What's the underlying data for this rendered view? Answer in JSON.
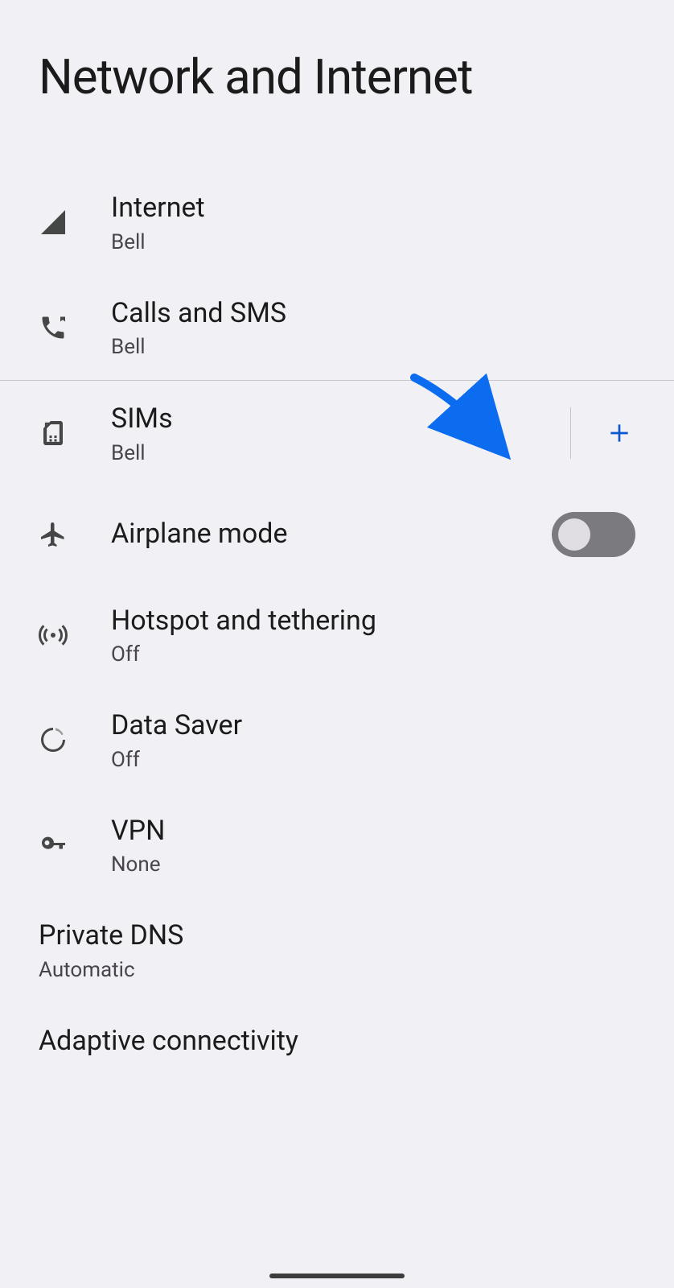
{
  "header": {
    "title": "Network and Internet"
  },
  "items": {
    "internet": {
      "title": "Internet",
      "sub": "Bell"
    },
    "calls_sms": {
      "title": "Calls and SMS",
      "sub": "Bell"
    },
    "sims": {
      "title": "SIMs",
      "sub": "Bell"
    },
    "airplane": {
      "title": "Airplane mode",
      "state": "off"
    },
    "hotspot": {
      "title": "Hotspot and tethering",
      "sub": "Off"
    },
    "data_saver": {
      "title": "Data Saver",
      "sub": "Off"
    },
    "vpn": {
      "title": "VPN",
      "sub": "None"
    },
    "private_dns": {
      "title": "Private DNS",
      "sub": "Automatic"
    },
    "adaptive": {
      "title": "Adaptive connectivity"
    }
  },
  "annotation": {
    "type": "arrow",
    "target": "add-sim-button",
    "color": "#0b6cf0"
  }
}
